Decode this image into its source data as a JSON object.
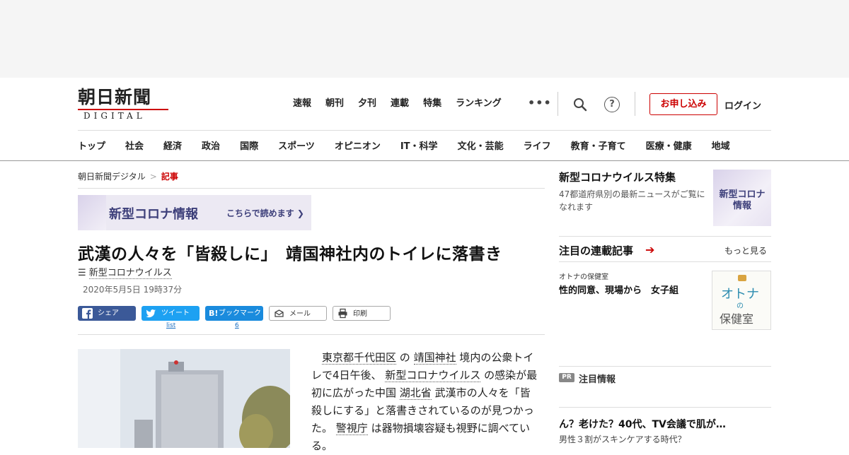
{
  "header": {
    "logo_main": "朝日新聞",
    "logo_sub": "DIGITAL",
    "topnav": [
      "速報",
      "朝刊",
      "夕刊",
      "連載",
      "特集",
      "ランキング"
    ],
    "more": "•••",
    "help": "?",
    "apply_label": "お申し込み",
    "login_label": "ログイン",
    "categories": [
      "トップ",
      "社会",
      "経済",
      "政治",
      "国際",
      "スポーツ",
      "オピニオン",
      "IT・科学",
      "文化・芸能",
      "ライフ",
      "教育・子育て",
      "医療・健康",
      "地域"
    ]
  },
  "breadcrumb": {
    "home": "朝日新聞デジタル",
    "sep": ">",
    "current": "記事"
  },
  "banner": {
    "title": "新型コロナ情報",
    "link": "こちらで読めます ❯"
  },
  "article": {
    "headline": "武漢の人々を「皆殺しに」　靖国神社内のトイレに落書き",
    "tag_icon": "☰",
    "tag": "新型コロナウイルス",
    "date": "2020年5月5日 19時37分",
    "body": {
      "p1": "　",
      "l1": "東京都千代田区",
      "t1": " の ",
      "l2": "靖国神社",
      "t2": " 境内の公衆トイレで4日午後、 ",
      "l3": "新型コロナウイルス",
      "t3": " の感染が最初に広がった中国 ",
      "l4": "湖北省",
      "t4": " 武漢市の人々を「皆殺しにする」と落書きされているのが見つかった。 ",
      "l5": "警視庁",
      "t5": " は器物損壊容疑も視野に調べている。"
    }
  },
  "share": {
    "facebook": "シェア",
    "twitter": "ツイート",
    "twitter_count": "list",
    "hatena_icon": "B!",
    "hatena": "ブックマーク",
    "hatena_count": "6",
    "mail": "メール",
    "print": "印刷"
  },
  "sidebar": {
    "feature_title": "新型コロナウイルス特集",
    "feature_desc": "47都道府県別の最新ニュースがご覧になれます",
    "feature_thumb": "新型コロナ情報",
    "series_title": "注目の連載記事",
    "series_arrow": "➔",
    "series_more": "もっと見る",
    "series_category": "オトナの保健室",
    "series_headline": "性的同意、現場から　女子組",
    "series_thumb_1": "オトナ",
    "series_thumb_2": "の",
    "series_thumb_3": "保健室",
    "pr_badge": "PR",
    "pr_title": "注目情報",
    "ad_headline": "ん？老けた？40代、TV会議で肌が…",
    "ad_sub": "男性３割がスキンケアする時代？"
  },
  "colors": {
    "brand_red": "#cc0000",
    "facebook": "#3b5998",
    "twitter": "#1da1f2",
    "hatena": "#1a8bdd",
    "corona_purple": "#3d3f7a"
  }
}
